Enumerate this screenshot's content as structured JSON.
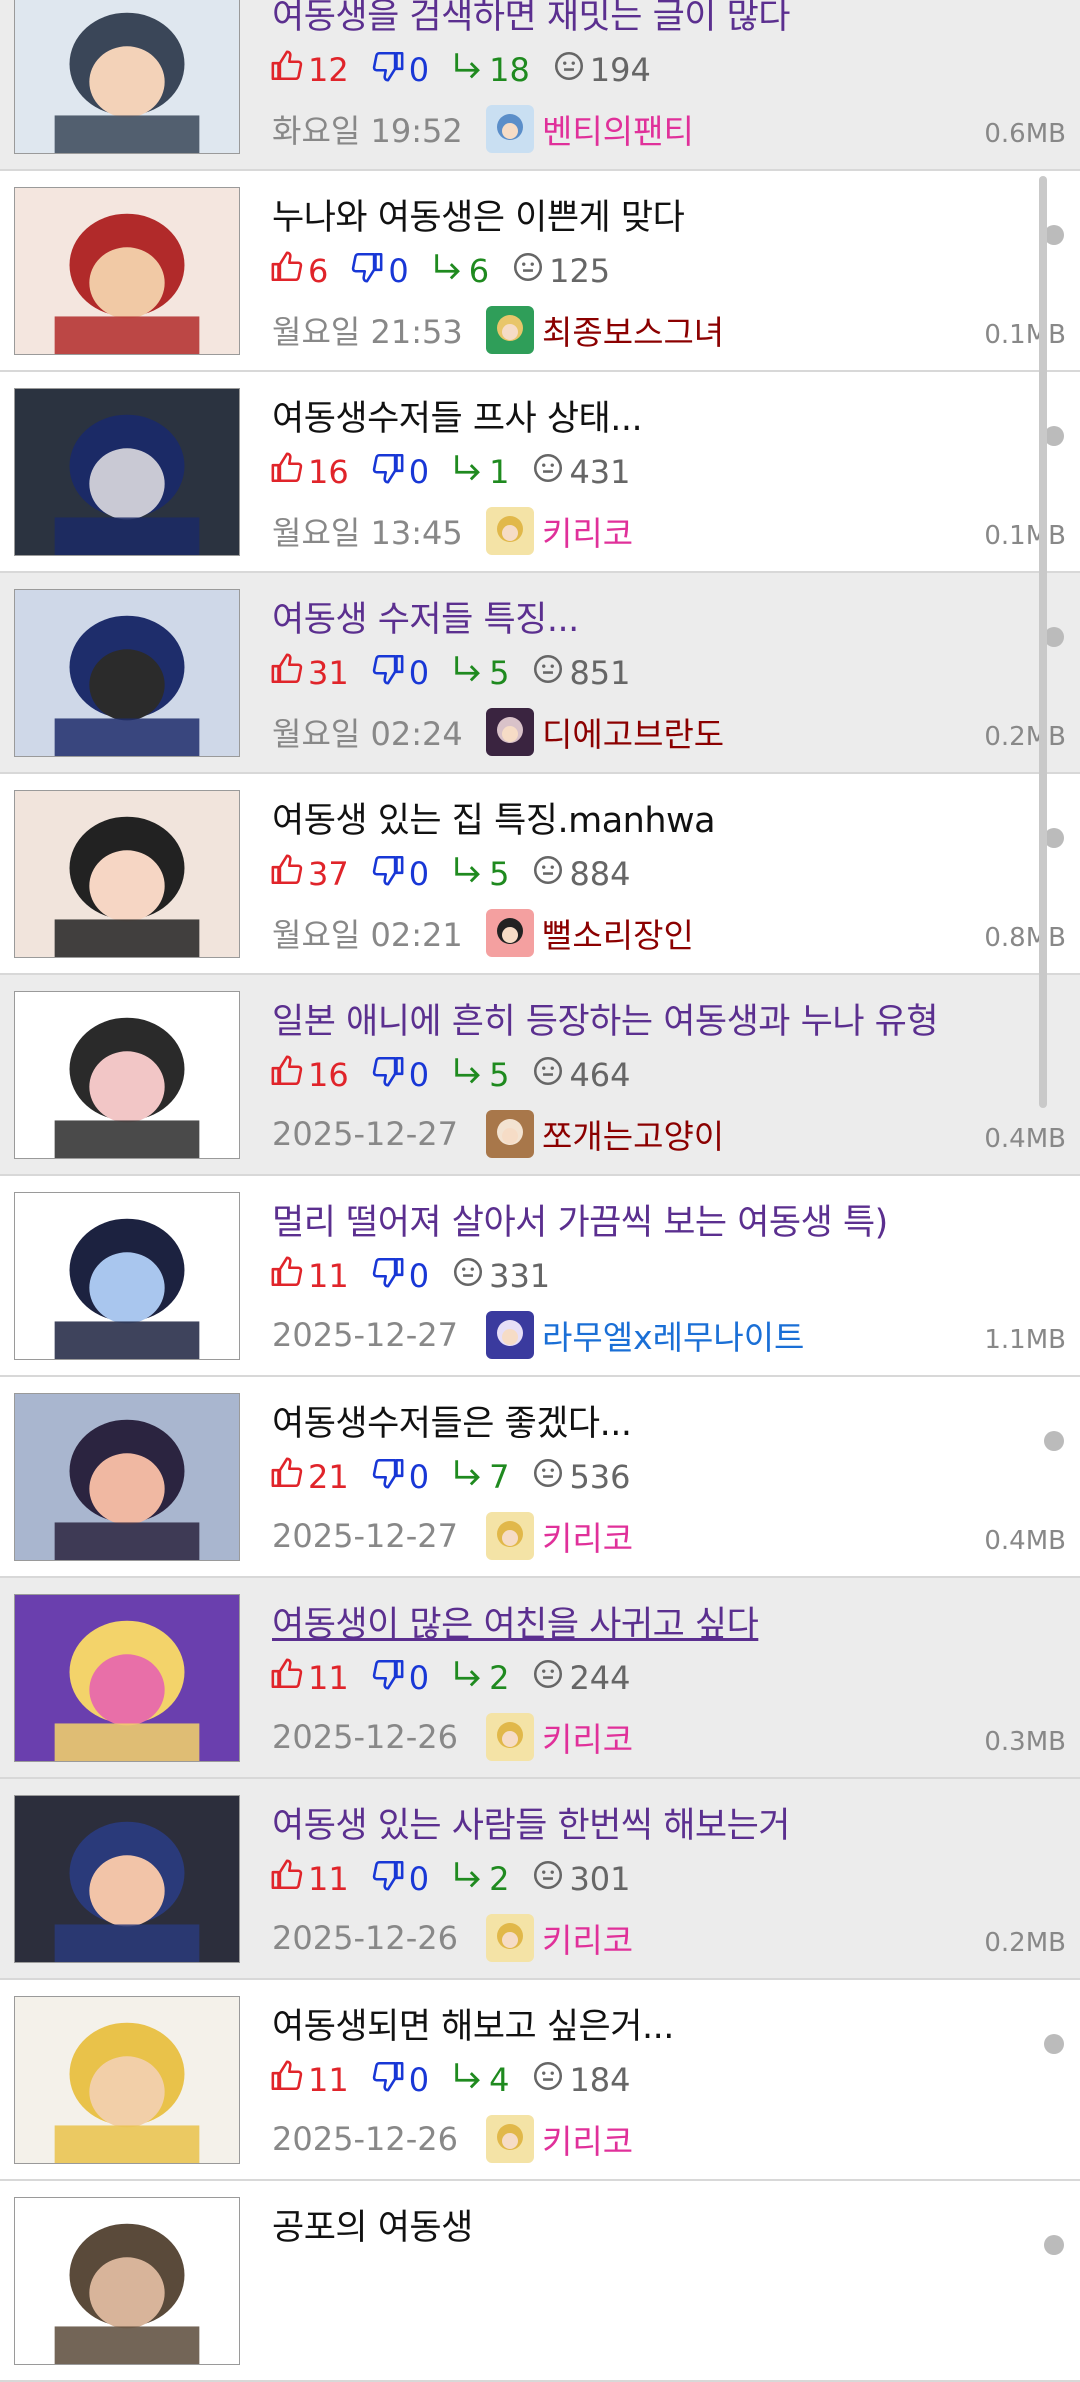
{
  "colors": {
    "upvote": "#e0242a",
    "downvote": "#1837d6",
    "reply": "#1f8a1f",
    "views": "#666666",
    "visited_title": "#5b2f8f",
    "author_pink": "#e0309a",
    "author_maroon": "#8b0000",
    "author_blue": "#1a6fd6"
  },
  "posts": [
    {
      "title": "여동생을 검색하면 재밋는 글이 많다",
      "visited": true,
      "underline": false,
      "background": "gray",
      "upvotes": "12",
      "downvotes": "0",
      "replies": "18",
      "views": "194",
      "date": "화요일 19:52",
      "author": "벤티의팬티",
      "author_color": "#e0309a",
      "size": "0.6MB",
      "thumb": [
        "#dfe7ef",
        "#3a4658",
        "#f3d2b8"
      ],
      "avatar": [
        "#c9dff2",
        "#5b8ec9"
      ],
      "dot": false
    },
    {
      "title": "누나와 여동생은 이쁜게 맞다",
      "visited": false,
      "underline": false,
      "background": "white",
      "upvotes": "6",
      "downvotes": "0",
      "replies": "6",
      "views": "125",
      "date": "월요일 21:53",
      "author": "최종보스그녀",
      "author_color": "#8b0000",
      "size": "0.1MB",
      "thumb": [
        "#f4e6df",
        "#b12a2a",
        "#f1c9a5"
      ],
      "avatar": [
        "#2f9e59",
        "#e8c66a"
      ],
      "dot": true
    },
    {
      "title": "여동생수저들 프사 상태...",
      "visited": false,
      "underline": false,
      "background": "white",
      "upvotes": "16",
      "downvotes": "0",
      "replies": "1",
      "views": "431",
      "date": "월요일 13:45",
      "author": "키리코",
      "author_color": "#e0309a",
      "size": "0.1MB",
      "thumb": [
        "#2b3340",
        "#1b2a66",
        "#c9c9d4"
      ],
      "avatar": [
        "#f4e3a6",
        "#e1b84a"
      ],
      "dot": true
    },
    {
      "title": "여동생 수저들 특징...",
      "visited": true,
      "underline": false,
      "background": "gray",
      "upvotes": "31",
      "downvotes": "0",
      "replies": "5",
      "views": "851",
      "date": "월요일 02:24",
      "author": "디에고브란도",
      "author_color": "#8b0000",
      "size": "0.2MB",
      "thumb": [
        "#cfd8e8",
        "#1e2d6b",
        "#2b2b2b"
      ],
      "avatar": [
        "#3a2440",
        "#d9c2c9"
      ],
      "dot": true
    },
    {
      "title": "여동생 있는 집 특징.manhwa",
      "visited": false,
      "underline": false,
      "background": "white",
      "upvotes": "37",
      "downvotes": "0",
      "replies": "5",
      "views": "884",
      "date": "월요일 02:21",
      "author": "뻘소리장인",
      "author_color": "#8b0000",
      "size": "0.8MB",
      "thumb": [
        "#f1e4dc",
        "#222222",
        "#f6d6c4"
      ],
      "avatar": [
        "#f4a0a0",
        "#222222"
      ],
      "dot": true
    },
    {
      "title": "일본 애니에 흔히 등장하는 여동생과 누나 유형",
      "visited": true,
      "underline": false,
      "background": "gray",
      "upvotes": "16",
      "downvotes": "0",
      "replies": "5",
      "views": "464",
      "date": "2025-12-27",
      "author": "쪼개는고양이",
      "author_color": "#8b0000",
      "size": "0.4MB",
      "thumb": [
        "#ffffff",
        "#2a2a2a",
        "#f2c6c6"
      ],
      "avatar": [
        "#a8774a",
        "#f3e3d2"
      ],
      "dot": false
    },
    {
      "title": "멀리 떨어져 살아서 가끔씩 보는 여동생 특)",
      "visited": true,
      "underline": false,
      "background": "white",
      "upvotes": "11",
      "downvotes": "0",
      "replies": "",
      "views": "331",
      "date": "2025-12-27",
      "author": "라무엘x레무나이트",
      "author_color": "#1a6fd6",
      "size": "1.1MB",
      "thumb": [
        "#ffffff",
        "#1c2240",
        "#a9c6ee"
      ],
      "avatar": [
        "#3a3a9e",
        "#e7dff7"
      ],
      "dot": false
    },
    {
      "title": "여동생수저들은 좋겠다...",
      "visited": false,
      "underline": false,
      "background": "white",
      "upvotes": "21",
      "downvotes": "0",
      "replies": "7",
      "views": "536",
      "date": "2025-12-27",
      "author": "키리코",
      "author_color": "#e0309a",
      "size": "0.4MB",
      "thumb": [
        "#a9b6cf",
        "#2b2440",
        "#f0b8a2"
      ],
      "avatar": [
        "#f4e3a6",
        "#e1b84a"
      ],
      "dot": true
    },
    {
      "title": "여동생이 많은 여친을 사귀고 싶다",
      "visited": true,
      "underline": true,
      "background": "gray",
      "upvotes": "11",
      "downvotes": "0",
      "replies": "2",
      "views": "244",
      "date": "2025-12-26",
      "author": "키리코",
      "author_color": "#e0309a",
      "size": "0.3MB",
      "thumb": [
        "#6a3fae",
        "#f3d36a",
        "#e86fa8"
      ],
      "avatar": [
        "#f4e3a6",
        "#e1b84a"
      ],
      "dot": false
    },
    {
      "title": "여동생 있는 사람들 한번씩 해보는거",
      "visited": true,
      "underline": false,
      "background": "gray",
      "upvotes": "11",
      "downvotes": "0",
      "replies": "2",
      "views": "301",
      "date": "2025-12-26",
      "author": "키리코",
      "author_color": "#e0309a",
      "size": "0.2MB",
      "thumb": [
        "#2c2e3c",
        "#2a3a7a",
        "#f2c4a8"
      ],
      "avatar": [
        "#f4e3a6",
        "#e1b84a"
      ],
      "dot": false
    },
    {
      "title": "여동생되면 해보고 싶은거...",
      "visited": false,
      "underline": false,
      "background": "white",
      "upvotes": "11",
      "downvotes": "0",
      "replies": "4",
      "views": "184",
      "date": "2025-12-26",
      "author": "키리코",
      "author_color": "#e0309a",
      "size": "",
      "thumb": [
        "#f4f1ea",
        "#e9c24a",
        "#f2cfa8"
      ],
      "avatar": [
        "#f4e3a6",
        "#e1b84a"
      ],
      "dot": true
    },
    {
      "title": "공포의 여동생",
      "visited": false,
      "underline": false,
      "background": "white",
      "upvotes": "",
      "downvotes": "",
      "replies": "",
      "views": "",
      "date": "",
      "author": "",
      "author_color": "#e0309a",
      "size": "",
      "thumb": [
        "#ffffff",
        "#5a4a3a",
        "#d8b49a"
      ],
      "avatar": [
        "#ffffff",
        "#ffffff"
      ],
      "dot": true
    }
  ]
}
